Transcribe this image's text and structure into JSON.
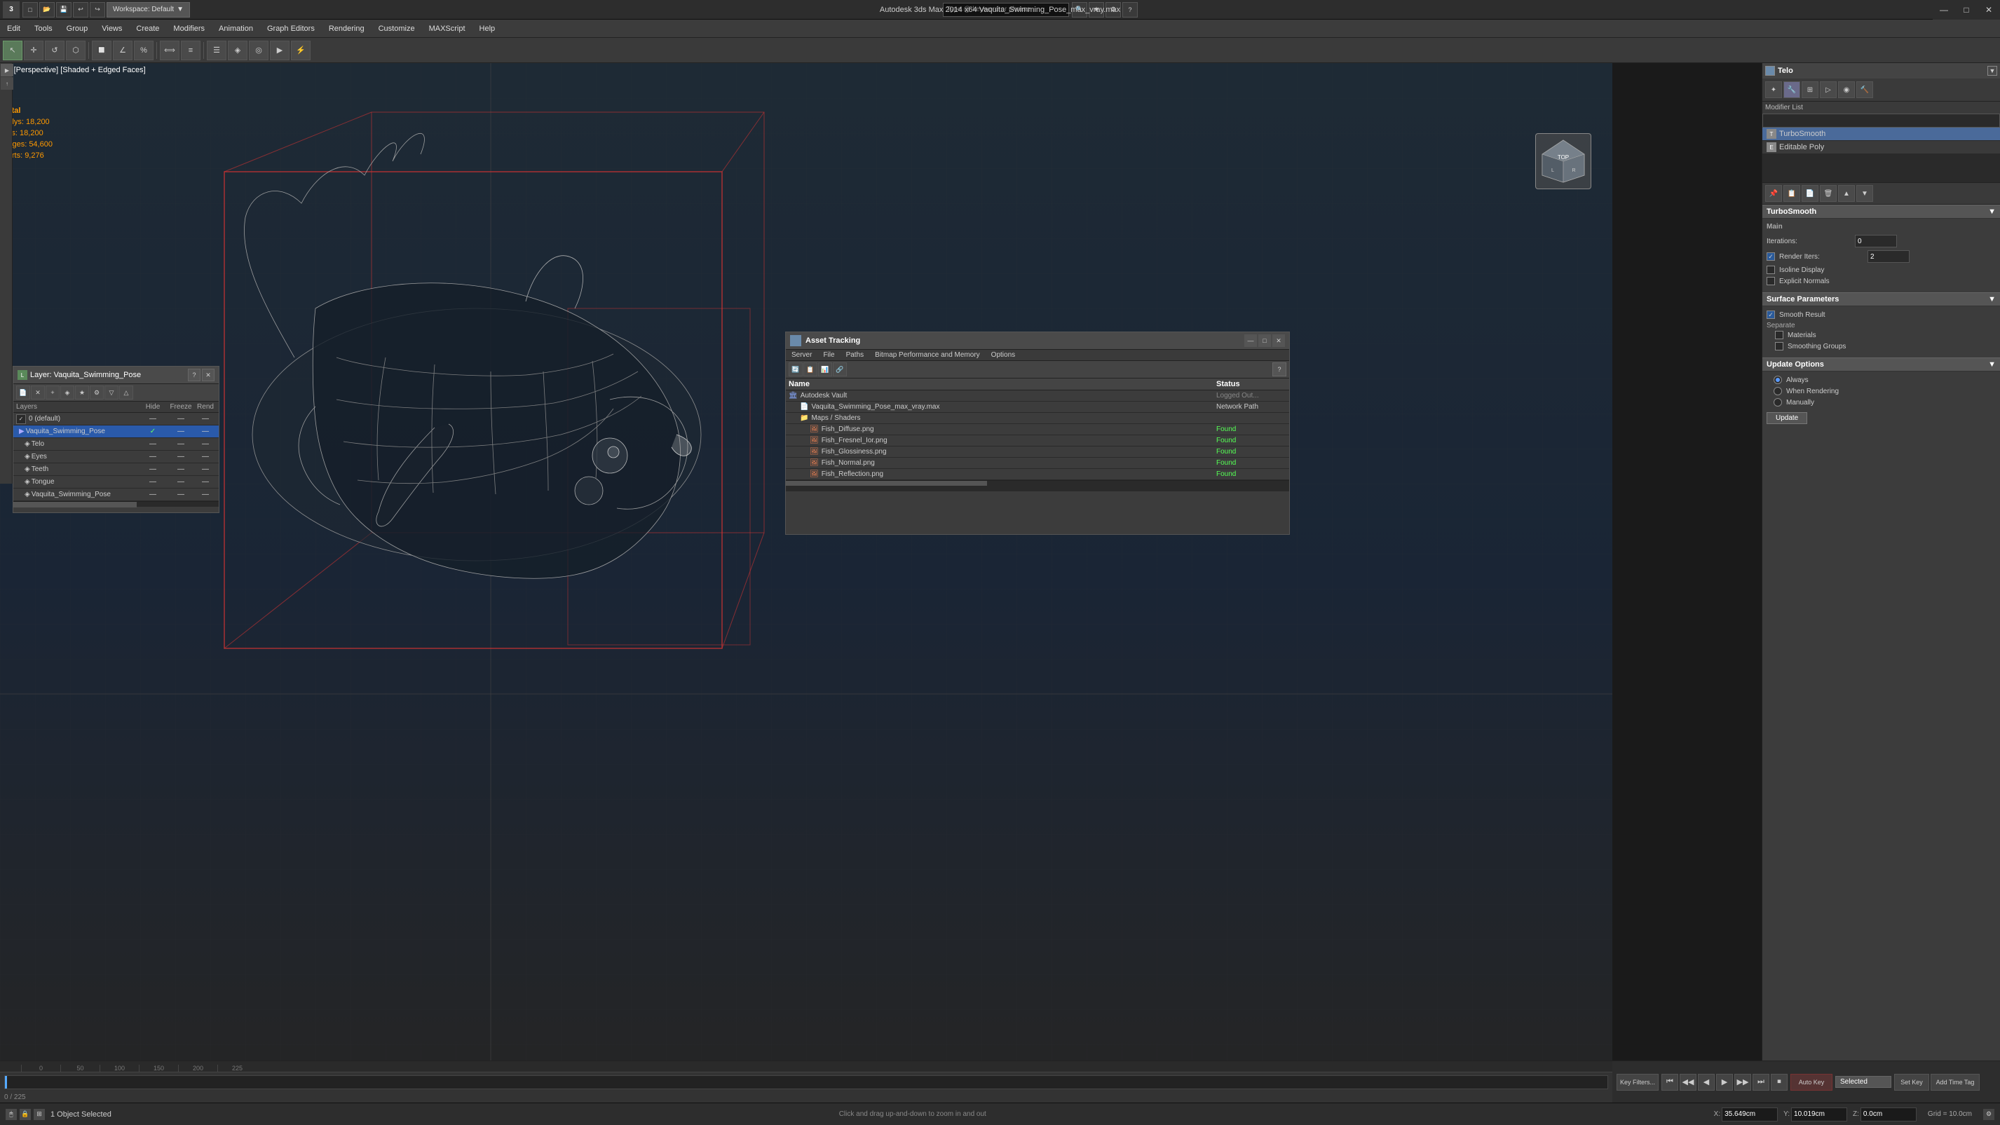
{
  "app": {
    "title": "Autodesk 3ds Max 2014 x64    Vaquita_Swimming_Pose_max_vray.max",
    "logo": "3",
    "workspace_label": "Workspace: Default"
  },
  "titlebar": {
    "search_placeholder": "Type @ keyword or phrase",
    "min_label": "—",
    "max_label": "□",
    "close_label": "✕"
  },
  "menubar": {
    "items": [
      {
        "label": "Edit"
      },
      {
        "label": "Tools"
      },
      {
        "label": "Group"
      },
      {
        "label": "Views"
      },
      {
        "label": "Create"
      },
      {
        "label": "Modifiers"
      },
      {
        "label": "Animation"
      },
      {
        "label": "Graph Editors"
      },
      {
        "label": "Rendering"
      },
      {
        "label": "Customize"
      },
      {
        "label": "MAXScript"
      },
      {
        "label": "Help"
      }
    ]
  },
  "viewport": {
    "label": "[+] [Perspective] [Shaded + Edged Faces]",
    "stats": {
      "total_label": "Total",
      "polys_label": "Polys:",
      "polys_value": "18,200",
      "tris_label": "Tris:",
      "tris_value": "18,200",
      "edges_label": "Edges:",
      "edges_value": "54,600",
      "verts_label": "Verts:",
      "verts_value": "9,276"
    }
  },
  "right_panel": {
    "object_name": "Telo",
    "modifier_list_label": "Modifier List",
    "modifiers": [
      {
        "name": "TurboSmooth",
        "selected": true
      },
      {
        "name": "Editable Poly",
        "selected": false
      }
    ],
    "turbosmooth": {
      "title": "TurboSmooth",
      "main_label": "Main",
      "iterations_label": "Iterations:",
      "iterations_value": "0",
      "render_iters_label": "Render Iters:",
      "render_iters_value": "2",
      "isoline_label": "Isoline Display",
      "explicit_label": "Explicit Normals",
      "surface_params_label": "Surface Parameters",
      "smooth_result_label": "Smooth Result",
      "smooth_result_checked": true,
      "separate_label": "Separate",
      "materials_label": "Materials",
      "materials_checked": false,
      "smoothing_groups_label": "Smoothing Groups",
      "smoothing_groups_checked": false,
      "update_options_label": "Update Options",
      "always_label": "Always",
      "always_checked": true,
      "when_rendering_label": "When Rendering",
      "when_rendering_checked": false,
      "manually_label": "Manually",
      "manually_checked": false,
      "update_btn_label": "Update"
    }
  },
  "layer_panel": {
    "title": "Layer: Vaquita_Swimming_Pose",
    "columns": {
      "name": "Layers",
      "hide": "Hide",
      "freeze": "Freeze",
      "rend": "Rend"
    },
    "layers": [
      {
        "name": "0 (default)",
        "indent": 0,
        "selected": false,
        "has_check": true
      },
      {
        "name": "Vaquita_Swimming_Pose",
        "indent": 0,
        "selected": true,
        "has_check": false
      },
      {
        "name": "Telo",
        "indent": 1,
        "selected": false,
        "has_check": false
      },
      {
        "name": "Eyes",
        "indent": 1,
        "selected": false,
        "has_check": false
      },
      {
        "name": "Teeth",
        "indent": 1,
        "selected": false,
        "has_check": false
      },
      {
        "name": "Tongue",
        "indent": 1,
        "selected": false,
        "has_check": false
      },
      {
        "name": "Vaquita_Swimming_Pose",
        "indent": 1,
        "selected": false,
        "has_check": false
      }
    ]
  },
  "asset_panel": {
    "title": "Asset Tracking",
    "menus": [
      "Server",
      "File",
      "Paths",
      "Bitmap Performance and Memory",
      "Options"
    ],
    "columns": {
      "name": "Name",
      "status": "Status"
    },
    "rows": [
      {
        "name": "Autodesk Vault",
        "indent": 0,
        "status": "Logged Out...",
        "status_class": "logged",
        "icon": "vault"
      },
      {
        "name": "Vaquita_Swimming_Pose_max_vray.max",
        "indent": 1,
        "status": "Network Path",
        "status_class": "network",
        "icon": "file"
      },
      {
        "name": "Maps / Shaders",
        "indent": 1,
        "status": "",
        "status_class": "",
        "icon": "folder"
      },
      {
        "name": "Fish_Diffuse.png",
        "indent": 2,
        "status": "Found",
        "status_class": "found",
        "icon": "img"
      },
      {
        "name": "Fish_Fresnel_Ior.png",
        "indent": 2,
        "status": "Found",
        "status_class": "found",
        "icon": "img"
      },
      {
        "name": "Fish_Glossiness.png",
        "indent": 2,
        "status": "Found",
        "status_class": "found",
        "icon": "img"
      },
      {
        "name": "Fish_Normal.png",
        "indent": 2,
        "status": "Found",
        "status_class": "found",
        "icon": "img"
      },
      {
        "name": "Fish_Reflection.png",
        "indent": 2,
        "status": "Found",
        "status_class": "found",
        "icon": "img"
      }
    ]
  },
  "statusbar": {
    "selected_text": "1 Object Selected",
    "hint_text": "Click and drag up-and-down to zoom in and out",
    "x_label": "X:",
    "x_value": "35.649cm",
    "y_label": "Y:",
    "y_value": "10.019cm",
    "z_label": "Z:",
    "z_value": "0.0cm",
    "grid_label": "Grid = 10.0cm",
    "auto_key_label": "Auto Key",
    "selected_dropdown": "Selected",
    "frame_value": "0 / 225"
  },
  "timeline": {
    "ruler_marks": [
      "0",
      "50",
      "100",
      "150",
      "200"
    ],
    "frame_counter": "0 / 225"
  }
}
